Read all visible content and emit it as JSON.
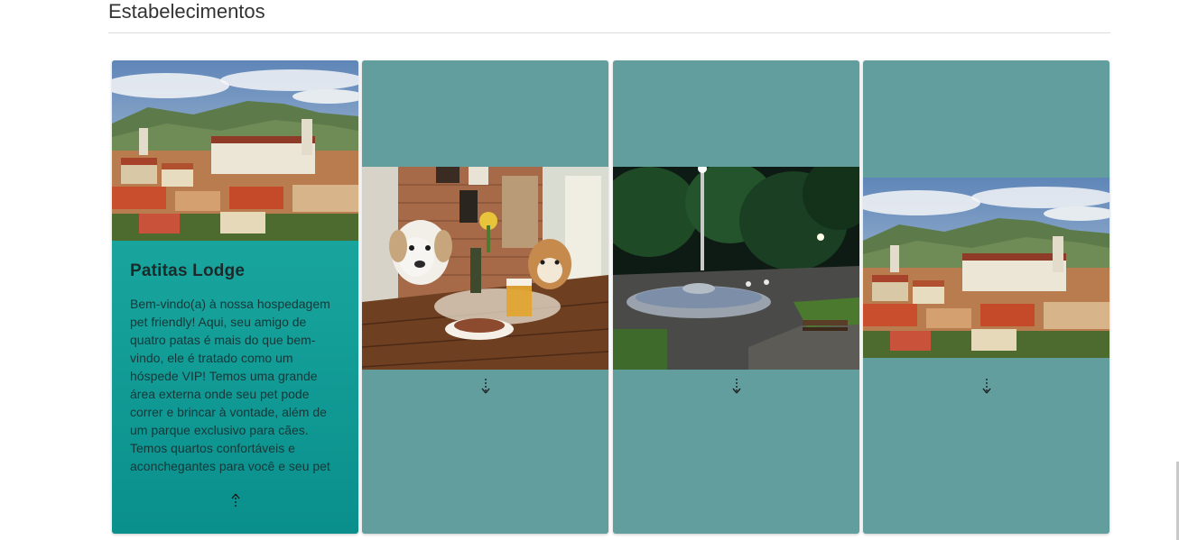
{
  "section": {
    "title": "Estabelecimentos"
  },
  "cards": [
    {
      "state": "expanded",
      "title": "Patitas Lodge",
      "description": "Bem-vindo(a) à nossa hospedagem pet friendly! Aqui, seu amigo de quatro patas é mais do que bem-vindo, ele é tratado como um hóspede VIP! Temos uma grande área externa onde seu pet pode correr e brincar à vontade, além de um parque exclusivo para cães. Temos quartos confortáveis e aconchegantes para você e seu pet",
      "image": "colonial-town-mountains",
      "toggle_icon": "arrow-up-icon"
    },
    {
      "state": "collapsed",
      "image": "dogs-at-restaurant-table",
      "toggle_icon": "arrow-down-icon"
    },
    {
      "state": "collapsed",
      "image": "night-plaza-fountain",
      "toggle_icon": "arrow-down-icon"
    },
    {
      "state": "collapsed",
      "image": "colonial-town-mountains",
      "toggle_icon": "arrow-down-icon"
    }
  ],
  "colors": {
    "expanded_card": "#1fb0a6",
    "collapsed_card": "#639e9e"
  }
}
